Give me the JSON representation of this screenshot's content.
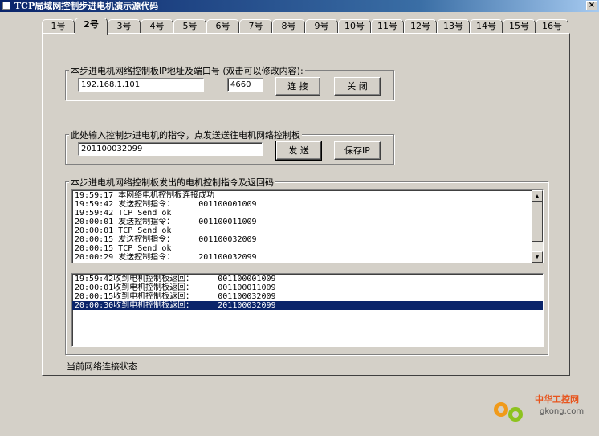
{
  "window": {
    "title": "TCP局域网控制步进电机演示源代码",
    "close_label": "×"
  },
  "tabs": [
    "1号",
    "2号",
    "3号",
    "4号",
    "5号",
    "6号",
    "7号",
    "8号",
    "9号",
    "10号",
    "11号",
    "12号",
    "13号",
    "14号",
    "15号",
    "16号"
  ],
  "active_tab": 1,
  "ip_group": {
    "legend": "本步进电机网络控制板IP地址及端口号 (双击可以修改内容):",
    "ip_value": "192.168.1.101",
    "port_value": "4660",
    "connect_label": "连 接",
    "close_label": "关 闭"
  },
  "cmd_group": {
    "legend": "此处输入控制步进电机的指令，点发送送往电机网络控制板",
    "command_value": "201100032099",
    "send_label": "发 送",
    "save_ip_label": "保存IP"
  },
  "log_group": {
    "legend": "本步进电机网络控制板发出的电机控制指令及返回码",
    "log_lines": [
      "19:59:17 本网络电机控制板连接成功",
      "19:59:42 发送控制指令：     001100001009",
      "19:59:42 TCP Send ok",
      "20:00:01 发送控制指令：     001100011009",
      "20:00:01 TCP Send ok",
      "20:00:15 发送控制指令：     001100032009",
      "20:00:15 TCP Send ok",
      "20:00:29 发送控制指令：     201100032099"
    ],
    "reply_lines": [
      "19:59:42收到电机控制板返回：     001100001009",
      "20:00:01收到电机控制板返回：     001100011009",
      "20:00:15收到电机控制板返回：     001100032009",
      "20:00:30收到电机控制板返回：     201100032099"
    ],
    "selected_reply": 3
  },
  "status_text": "当前网络连接状态",
  "watermark": {
    "brand": "中华工控网",
    "site": "gkong.com"
  },
  "colors": {
    "title_active": "#0a246a",
    "selection": "#0a246a",
    "face": "#d4d0c8"
  }
}
